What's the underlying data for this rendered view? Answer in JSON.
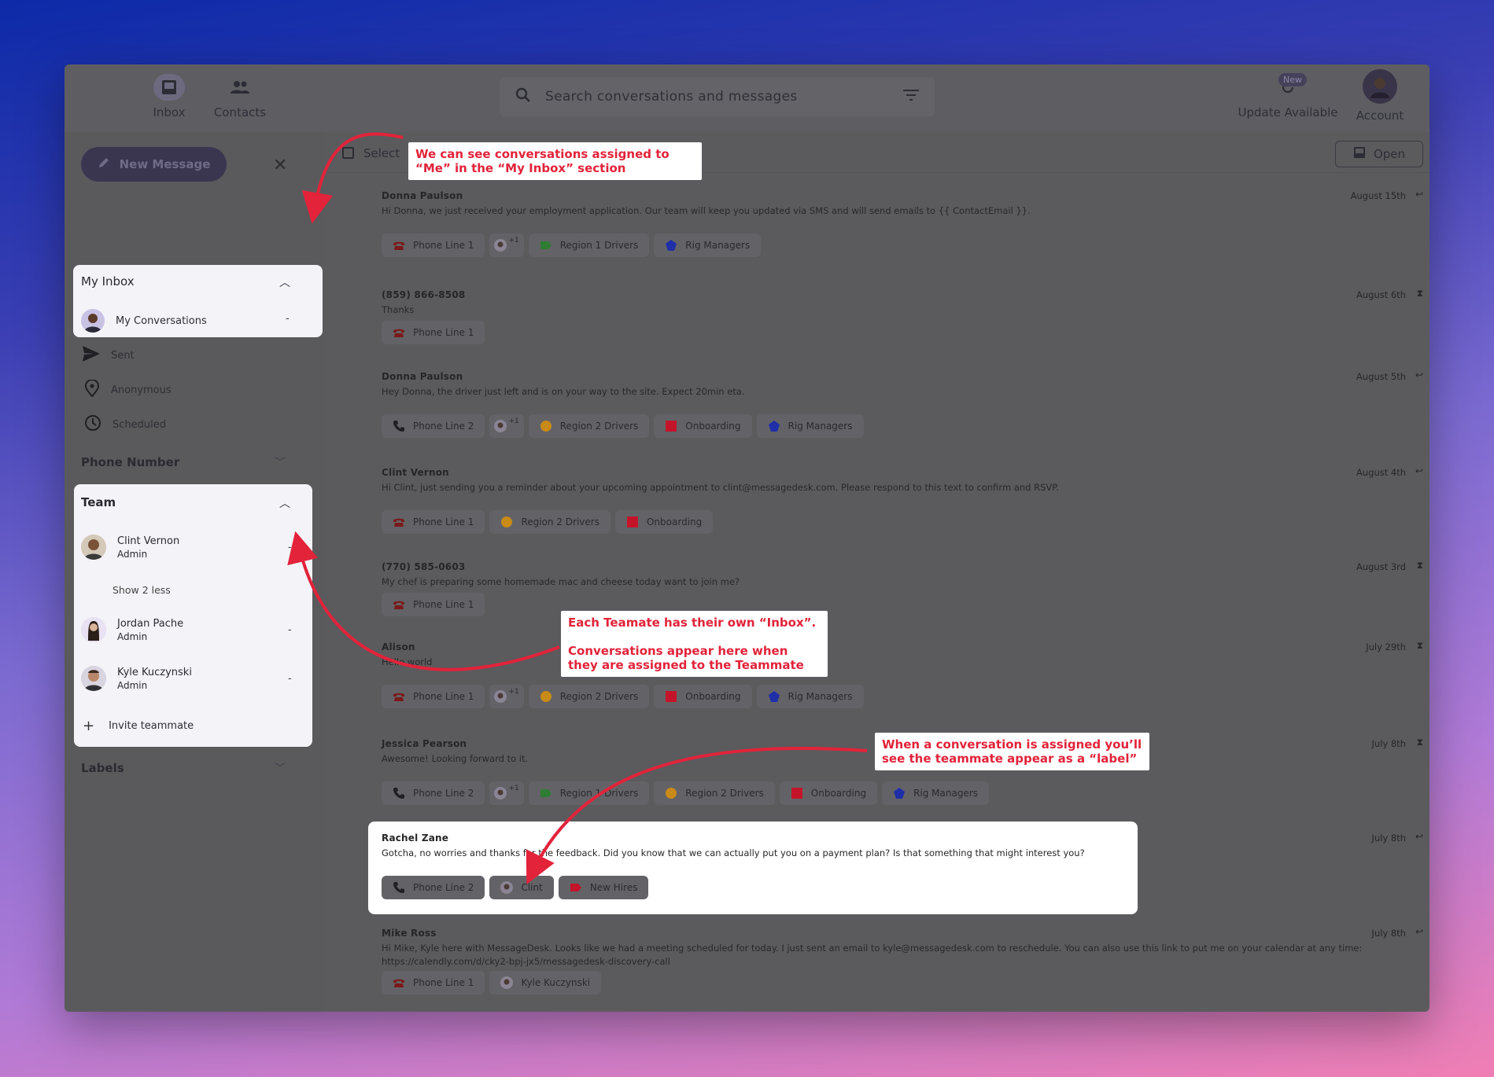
{
  "nav": {
    "inbox_label": "Inbox",
    "contacts_label": "Contacts",
    "update_label": "Update Available",
    "update_badge": "New",
    "account_label": "Account"
  },
  "search": {
    "placeholder": "Search conversations and messages"
  },
  "sidebar": {
    "new_message_label": "New Message",
    "my_inbox": {
      "title": "My Inbox",
      "item": "My Conversations",
      "count": "-"
    },
    "folders": [
      {
        "label": "Sent",
        "icon": "send-icon"
      },
      {
        "label": "Anonymous",
        "icon": "location-pin-icon"
      },
      {
        "label": "Scheduled",
        "icon": "clock-icon"
      }
    ],
    "phone_number_title": "Phone Number",
    "team": {
      "title": "Team",
      "members": [
        {
          "name": "Clint Vernon",
          "role": "Admin",
          "count": "-"
        },
        {
          "name": "Jordan Pache",
          "role": "Admin",
          "count": "-"
        },
        {
          "name": "Kyle Kuczynski",
          "role": "Admin",
          "count": "-"
        }
      ],
      "show_less": "Show 2 less",
      "invite": "Invite teammate"
    },
    "labels_title": "Labels"
  },
  "toolbar": {
    "select_label": "Select",
    "open_label": "Open"
  },
  "conversations": [
    {
      "name": "Donna Paulson",
      "preview": "Hi Donna, we just received your employment application. Our team will keep you updated via SMS and will send emails to {{ ContactEmail }}.",
      "date": "August 15th",
      "chips": [
        "Phone Line 1",
        "+1",
        "Region 1 Drivers",
        "Rig Managers"
      ]
    },
    {
      "name": "(859) 866-8508",
      "preview": "Thanks",
      "date": "August 6th",
      "chips": [
        "Phone Line 1"
      ]
    },
    {
      "name": "Donna Paulson",
      "preview": "Hey Donna, the driver just left and is on your way to the site. Expect 20min eta.",
      "date": "August 5th",
      "chips": [
        "Phone Line 2",
        "+1",
        "Region 2 Drivers",
        "Onboarding",
        "Rig Managers"
      ]
    },
    {
      "name": "Clint Vernon",
      "preview": "Hi Clint, just sending you a reminder about your upcoming appointment to clint@messagedesk.com. Please respond to this text to confirm and RSVP.",
      "date": "August 4th",
      "chips": [
        "Phone Line 1",
        "Region 2 Drivers",
        "Onboarding"
      ]
    },
    {
      "name": "(770) 585-0603",
      "preview": "My chef is preparing some homemade mac and cheese today want to join me?",
      "date": "August 3rd",
      "chips": [
        "Phone Line 1"
      ]
    },
    {
      "name": "Alison",
      "preview": "Hello world",
      "date": "July 29th",
      "chips": [
        "Phone Line 1",
        "+1",
        "Region 2 Drivers",
        "Onboarding",
        "Rig Managers"
      ]
    },
    {
      "name": "Jessica Pearson",
      "preview": "Awesome! Looking forward to it.",
      "date": "July 8th",
      "chips": [
        "Phone Line 2",
        "+1",
        "Region 1 Drivers",
        "Region 2 Drivers",
        "Onboarding",
        "Rig Managers"
      ]
    },
    {
      "name": "Rachel Zane",
      "preview": "Gotcha, no worries and thanks for the feedback. Did you know that we can actually put you on a payment plan? Is that something that might interest you?",
      "date": "July 8th",
      "chips": [
        "Phone Line 2",
        "Clint",
        "New Hires"
      ]
    },
    {
      "name": "Mike Ross",
      "preview": "Hi Mike, Kyle here with MessageDesk. Looks like we had a meeting scheduled for today. I just sent an email to kyle@messagedesk.com to reschedule. You can also use this link to put me on your calendar at any time: https://calendly.com/d/cky2-bpj-jx5/messagedesk-discovery-call",
      "date": "July 8th",
      "chips": [
        "Phone Line 1",
        "Kyle Kuczynski"
      ]
    }
  ],
  "annotations": {
    "a1": "We can see conversations assigned to “Me” in the “My Inbox” section",
    "a2_line1": "Each Teamate has their own “Inbox”.",
    "a2_line2": "Conversations appear here when they are assigned to the Teammate",
    "a3": "When a conversation is assigned you’ll see the teammate appear as a “label”"
  },
  "colors": {
    "accent": "#3a3650",
    "annotation": "#e2233a",
    "label_green": "#2e7d32",
    "label_orange": "#c98a17",
    "label_red": "#c4142a",
    "label_blue": "#1f2fa8"
  }
}
